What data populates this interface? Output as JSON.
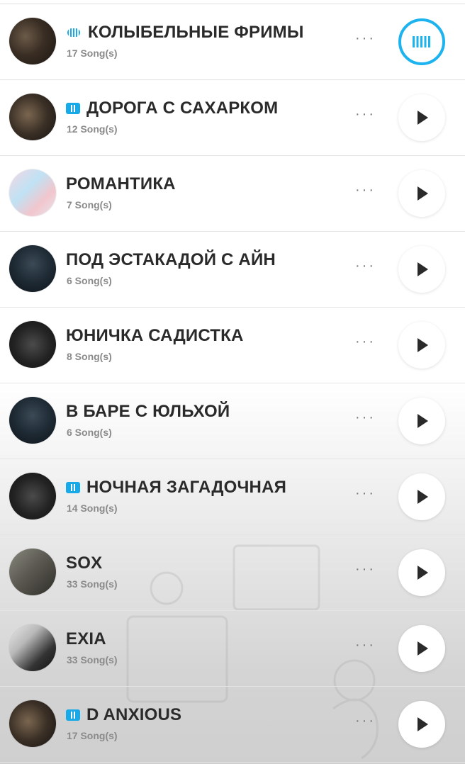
{
  "colors": {
    "accent": "#1cb3ee",
    "title": "#2a2a2a",
    "subtitle": "#8a8a8a"
  },
  "playlists": [
    {
      "title": "КОЛЫБЕЛЬНЫЕ ФРИМЫ",
      "count": "17 Song(s)",
      "badge": "wave-icon",
      "state": "playing",
      "cover": "cover-1"
    },
    {
      "title": "ДОРОГА С САХАРКОМ",
      "count": "12 Song(s)",
      "badge": "download-badge-icon",
      "state": "idle",
      "cover": "cover-2"
    },
    {
      "title": "РОМАНТИКА",
      "count": "7 Song(s)",
      "badge": "",
      "state": "idle",
      "cover": "cover-3"
    },
    {
      "title": "ПОД ЭСТАКАДОЙ С АЙН",
      "count": "6 Song(s)",
      "badge": "",
      "state": "idle",
      "cover": "cover-4"
    },
    {
      "title": "ЮНИЧКА САДИСТКА",
      "count": "8 Song(s)",
      "badge": "",
      "state": "idle",
      "cover": "cover-5"
    },
    {
      "title": "В БАРЕ С ЮЛЬХОЙ",
      "count": "6 Song(s)",
      "badge": "",
      "state": "idle",
      "cover": "cover-4"
    },
    {
      "title": "НОЧНАЯ ЗАГАДОЧНАЯ",
      "count": "14 Song(s)",
      "badge": "download-badge-icon",
      "state": "idle",
      "cover": "cover-5"
    },
    {
      "title": "SOX",
      "count": "33 Song(s)",
      "badge": "",
      "state": "idle",
      "cover": "cover-6"
    },
    {
      "title": "EXIA",
      "count": "33 Song(s)",
      "badge": "",
      "state": "idle",
      "cover": "cover-7"
    },
    {
      "title": "D ANXIOUS",
      "count": "17 Song(s)",
      "badge": "download-badge-icon",
      "state": "idle",
      "cover": "cover-2"
    }
  ],
  "icons": {
    "more": "more-dots-icon",
    "play": "play-icon",
    "playing": "equalizer-icon"
  },
  "more_label": "···"
}
